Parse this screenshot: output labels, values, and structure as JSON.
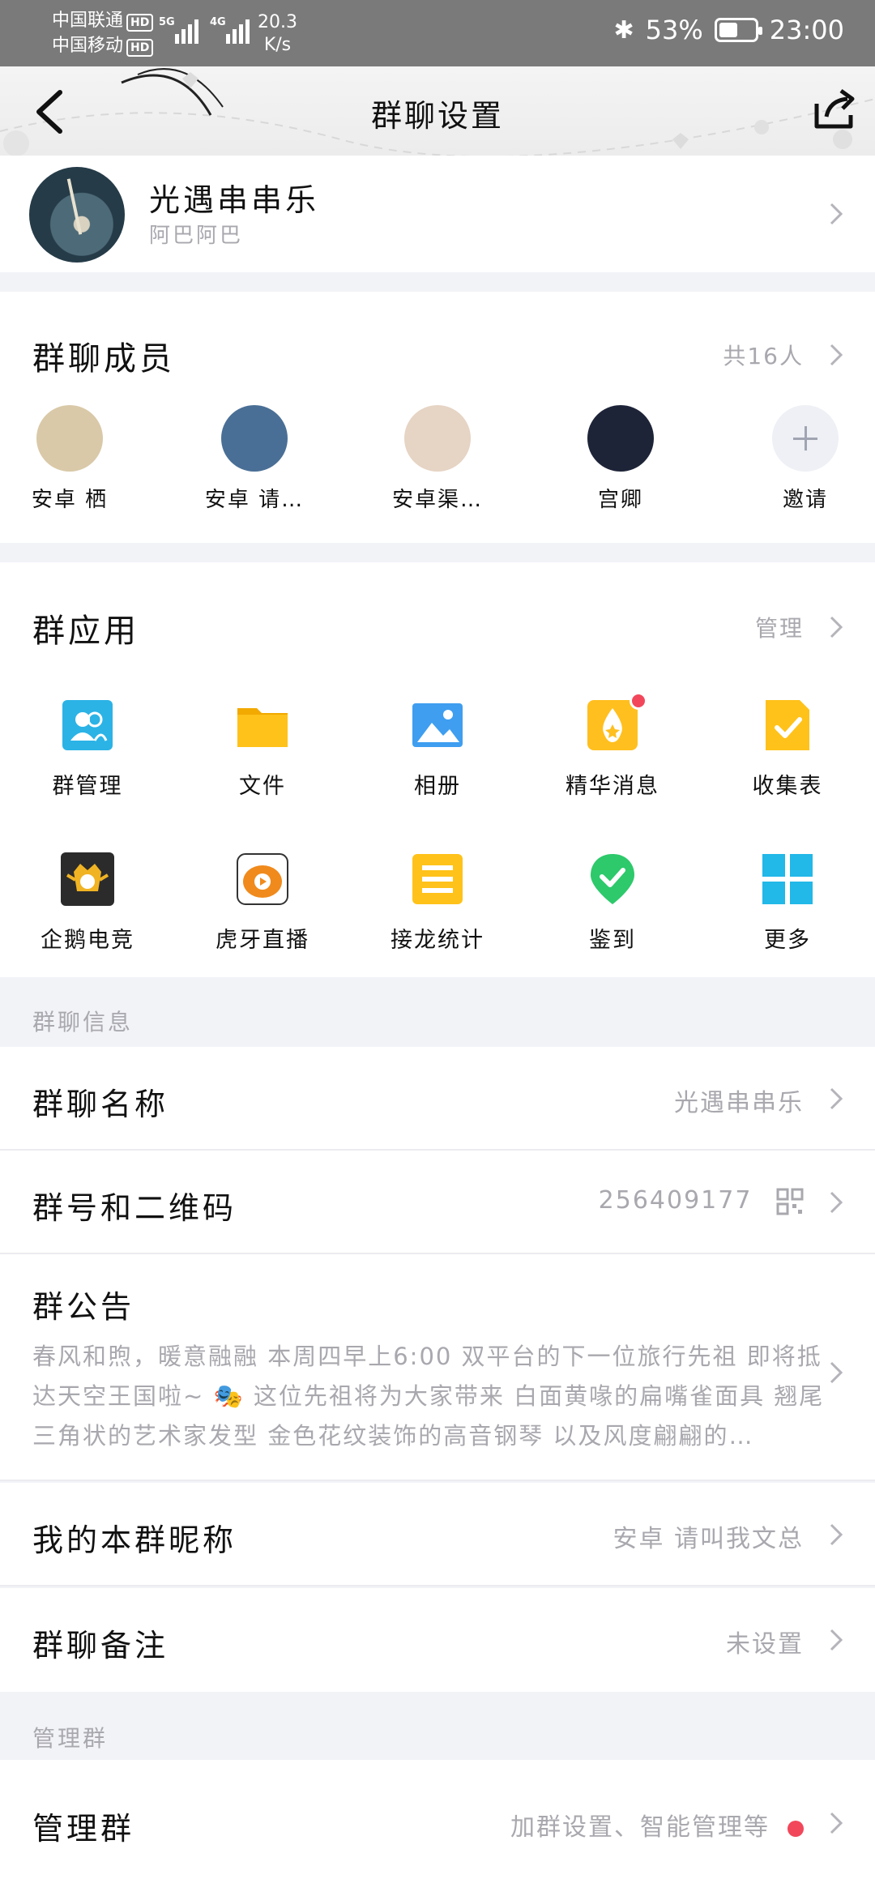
{
  "status_bar": {
    "carrier_1": "中国联通",
    "carrier_2": "中国移动",
    "hd": "HD",
    "sig1_label": "5G",
    "sig2_label": "4G",
    "speed_value": "20.3",
    "speed_unit": "K/s",
    "battery": "53%",
    "battery_level": 0.53,
    "time": "23:00"
  },
  "nav": {
    "title": "群聊设置"
  },
  "group": {
    "name": "光遇串串乐",
    "subtitle": "阿巴阿巴"
  },
  "members": {
    "title": "群聊成员",
    "count": "共16人",
    "list": [
      {
        "name": "安卓 栖",
        "color": "#d9c9a8"
      },
      {
        "name": "安卓 请…",
        "color": "#4a6f96"
      },
      {
        "name": "安卓渠…",
        "color": "#e6d4c4"
      },
      {
        "name": "宫卿",
        "color": "#1e2438"
      }
    ],
    "invite_label": "邀请"
  },
  "apps": {
    "title": "群应用",
    "manage": "管理",
    "items": [
      {
        "label": "群管理",
        "icon": "group-manage-icon",
        "color": "#2bb3e6"
      },
      {
        "label": "文件",
        "icon": "folder-icon",
        "color": "#ffc21a"
      },
      {
        "label": "相册",
        "icon": "album-icon",
        "color": "#3f9ef0"
      },
      {
        "label": "精华消息",
        "icon": "essence-message-icon",
        "color": "#ffbf1f"
      },
      {
        "label": "收集表",
        "icon": "collection-form-icon",
        "color": "#ffc21a"
      },
      {
        "label": "企鹅电竞",
        "icon": "penguin-esports-icon",
        "color": "#2b2b2b"
      },
      {
        "label": "虎牙直播",
        "icon": "huya-live-icon",
        "color": "#f08a1c"
      },
      {
        "label": "接龙统计",
        "icon": "relay-stats-icon",
        "color": "#ffc21a"
      },
      {
        "label": "鉴到",
        "icon": "check-in-icon",
        "color": "#2dc96b"
      },
      {
        "label": "更多",
        "icon": "more-apps-icon",
        "color": "#22b8e8"
      }
    ]
  },
  "info": {
    "section_label": "群聊信息",
    "name_label": "群聊名称",
    "name_value": "光遇串串乐",
    "number_label": "群号和二维码",
    "number_value": "256409177",
    "notice_label": "群公告",
    "notice_text": "春风和煦，暖意融融 本周四早上6:00 双平台的下一位旅行先祖 即将抵达天空王国啦~ 🎭 这位先祖将为大家带来 白面黄喙的扁嘴雀面具 翘尾三角状的艺术家发型 金色花纹装饰的高音钢琴 以及风度翩翩的…",
    "nickname_label": "我的本群昵称",
    "nickname_value": "安卓 请叫我文总",
    "remark_label": "群聊备注",
    "remark_value": "未设置"
  },
  "admin": {
    "section_label": "管理群",
    "label": "管理群",
    "value": "加群设置、智能管理等"
  }
}
